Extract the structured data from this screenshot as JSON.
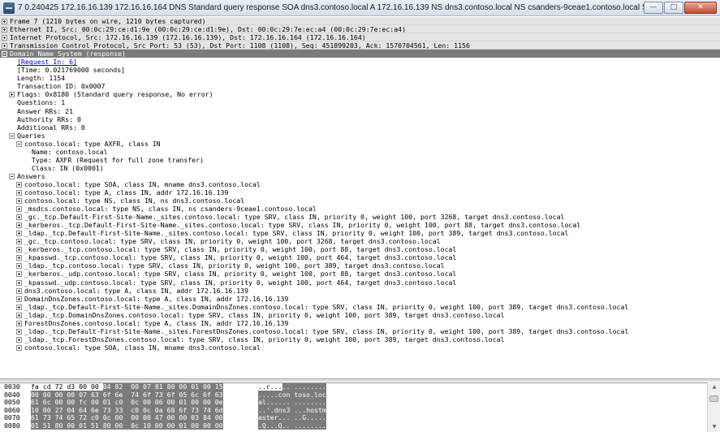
{
  "window": {
    "title": "7 0.240425 172.16.16.139 172.16.16.164 DNS Standard query response SOA dns3.contoso.local A 172.16.16.139 NS dns3.contoso.local NS csanders-9ceae1.contoso.local SRV 0 100 3268 dns3.contoso.local SRV 0 100 88 d...",
    "minimize_glyph": "—",
    "restore_glyph": "□",
    "close_glyph": "✕"
  },
  "tree": {
    "rows": [
      {
        "exp": "plus",
        "indent": 0,
        "text": "Frame 7 (1210 bytes on wire, 1210 bytes captured)",
        "style": "hdr"
      },
      {
        "exp": "plus",
        "indent": 0,
        "text": "Ethernet II, Src: 00:0c:29:ce:d1:9e (00:0c:29:ce:d1:9e), Dst: 00:0c:29:7e:ec:a4 (00:0c:29:7e:ec:a4)",
        "style": "hdr"
      },
      {
        "exp": "plus",
        "indent": 0,
        "text": "Internet Protocol, Src: 172.16.16.139 (172.16.16.139), Dst: 172.16.16.164 (172.16.16.164)",
        "style": "hdr"
      },
      {
        "exp": "plus",
        "indent": 0,
        "text": "Transmission Control Protocol, Src Port: 53 (53), Dst Port: 1108 (1108), Seq: 451899203, Ack: 1570704561, Len: 1156",
        "style": "hdr"
      },
      {
        "exp": "minus",
        "indent": 0,
        "text": "Domain Name System (response)",
        "style": "sel"
      },
      {
        "exp": "none",
        "indent": 1,
        "text": "[Request In: 6]",
        "style": "link"
      },
      {
        "exp": "none",
        "indent": 1,
        "text": "[Time: 0.021769000 seconds]"
      },
      {
        "exp": "none",
        "indent": 1,
        "text": "Length: 1154"
      },
      {
        "exp": "none",
        "indent": 1,
        "text": "Transaction ID: 0x0007"
      },
      {
        "exp": "plus",
        "indent": 1,
        "text": "Flags: 0x8180 (Standard query response, No error)"
      },
      {
        "exp": "none",
        "indent": 1,
        "text": "Questions: 1"
      },
      {
        "exp": "none",
        "indent": 1,
        "text": "Answer RRs: 21"
      },
      {
        "exp": "none",
        "indent": 1,
        "text": "Authority RRs: 0"
      },
      {
        "exp": "none",
        "indent": 1,
        "text": "Additional RRs: 0"
      },
      {
        "exp": "minus",
        "indent": 1,
        "text": "Queries"
      },
      {
        "exp": "minus",
        "indent": 2,
        "text": "contoso.local: type AXFR, class IN"
      },
      {
        "exp": "none",
        "indent": 3,
        "text": "Name: contoso.local"
      },
      {
        "exp": "none",
        "indent": 3,
        "text": "Type: AXFR (Request for full zone transfer)"
      },
      {
        "exp": "none",
        "indent": 3,
        "text": "Class: IN (0x0001)"
      },
      {
        "exp": "minus",
        "indent": 1,
        "text": "Answers"
      },
      {
        "exp": "plus",
        "indent": 2,
        "text": "contoso.local: type SOA, class IN, mname dns3.contoso.local"
      },
      {
        "exp": "plus",
        "indent": 2,
        "text": "contoso.local: type A, class IN, addr 172.16.16.139"
      },
      {
        "exp": "plus",
        "indent": 2,
        "text": "contoso.local: type NS, class IN, ns dns3.contoso.local"
      },
      {
        "exp": "plus",
        "indent": 2,
        "text": "_msdcs.contoso.local: type NS, class IN, ns csanders-9ceae1.contoso.local"
      },
      {
        "exp": "plus",
        "indent": 2,
        "text": "_gc._tcp.Default-First-Site-Name._sites.contoso.local: type SRV, class IN, priority 0, weight 100, port 3268, target dns3.contoso.local"
      },
      {
        "exp": "plus",
        "indent": 2,
        "text": "_kerberos._tcp.Default-First-Site-Name._sites.contoso.local: type SRV, class IN, priority 0, weight 100, port 88, target dns3.contoso.local"
      },
      {
        "exp": "plus",
        "indent": 2,
        "text": "_ldap._tcp.Default-First-Site-Name._sites.contoso.local: type SRV, class IN, priority 0, weight 100, port 389, target dns3.contoso.local"
      },
      {
        "exp": "plus",
        "indent": 2,
        "text": "_gc._tcp.contoso.local: type SRV, class IN, priority 0, weight 100, port 3268, target dns3.contoso.local"
      },
      {
        "exp": "plus",
        "indent": 2,
        "text": "_kerberos._tcp.contoso.local: type SRV, class IN, priority 0, weight 100, port 88, target dns3.contoso.local"
      },
      {
        "exp": "plus",
        "indent": 2,
        "text": "_kpasswd._tcp.contoso.local: type SRV, class IN, priority 0, weight 100, port 464, target dns3.contoso.local"
      },
      {
        "exp": "plus",
        "indent": 2,
        "text": "_ldap._tcp.contoso.local: type SRV, class IN, priority 0, weight 100, port 389, target dns3.contoso.local"
      },
      {
        "exp": "plus",
        "indent": 2,
        "text": "_kerberos._udp.contoso.local: type SRV, class IN, priority 0, weight 100, port 88, target dns3.contoso.local"
      },
      {
        "exp": "plus",
        "indent": 2,
        "text": "_kpasswd._udp.contoso.local: type SRV, class IN, priority 0, weight 100, port 464, target dns3.contoso.local"
      },
      {
        "exp": "plus",
        "indent": 2,
        "text": "dns3.contoso.local: type A, class IN, addr 172.16.16.139"
      },
      {
        "exp": "plus",
        "indent": 2,
        "text": "DomainDnsZones.contoso.local: type A, class IN, addr 172.16.16.139"
      },
      {
        "exp": "plus",
        "indent": 2,
        "text": "_ldap._tcp.Default-First-Site-Name._sites.DomainDnsZones.contoso.local: type SRV, class IN, priority 0, weight 100, port 389, target dns3.contoso.local"
      },
      {
        "exp": "plus",
        "indent": 2,
        "text": "_ldap._tcp.DomainDnsZones.contoso.local: type SRV, class IN, priority 0, weight 100, port 389, target dns3.contoso.local"
      },
      {
        "exp": "plus",
        "indent": 2,
        "text": "ForestDnsZones.contoso.local: type A, class IN, addr 172.16.16.139"
      },
      {
        "exp": "plus",
        "indent": 2,
        "text": "_ldap._tcp.Default-First-Site-Name._sites.ForestDnsZones.contoso.local: type SRV, class IN, priority 0, weight 100, port 389, target dns3.contoso.local"
      },
      {
        "exp": "plus",
        "indent": 2,
        "text": "_ldap._tcp.ForestDnsZones.contoso.local: type SRV, class IN, priority 0, weight 100, port 389, target dns3.contoso.local"
      },
      {
        "exp": "plus",
        "indent": 2,
        "text": "contoso.local: type SOA, class IN, mname dns3.contoso.local"
      }
    ]
  },
  "bytes": {
    "rows": [
      {
        "offset": "0030",
        "hex_plain": "fa cd 72 d3 00 00 ",
        "hex_hl": "04 82",
        "hex_tail": "  00 07 81 80 00 01 00 15",
        "ascii_plain": "..r...",
        "ascii_hl": ".. ........"
      },
      {
        "offset": "0040",
        "hex_plain": "",
        "hex_hl": "00 00 00 00 07 63 6f 6e  74 6f 73 6f 05 6c 6f 63",
        "hex_tail": "",
        "ascii_plain": "",
        "ascii_hl": ".....con toso.loc"
      },
      {
        "offset": "0050",
        "hex_plain": "",
        "hex_hl": "61 6c 00 00 fc 00 01 c0  0c 00 06 00 01 00 00 0e",
        "hex_tail": "",
        "ascii_plain": "",
        "ascii_hl": "al...... ........"
      },
      {
        "offset": "0060",
        "hex_plain": "",
        "hex_hl": "10 00 27 04 64 6e 73 33  c0 0c 0a 68 6f 73 74 6d",
        "hex_tail": "",
        "ascii_plain": "",
        "ascii_hl": "..'.dns3 ...hostm"
      },
      {
        "offset": "0070",
        "hex_plain": "",
        "hex_hl": "61 73 74 65 72 c0 0c 00  00 00 47 00 00 03 84 00",
        "hex_tail": "",
        "ascii_plain": "",
        "ascii_hl": "aster... ..G....."
      },
      {
        "offset": "0080",
        "hex_plain": "",
        "hex_hl": "01 51 80 00 01 51 80 00  0c 10 00 00 01 00 00 00",
        "hex_tail": "",
        "ascii_plain": "",
        "ascii_hl": ".Q...Q.. ........"
      }
    ]
  },
  "scrollbar": {
    "up_glyph": "▲",
    "down_glyph": "▼"
  }
}
